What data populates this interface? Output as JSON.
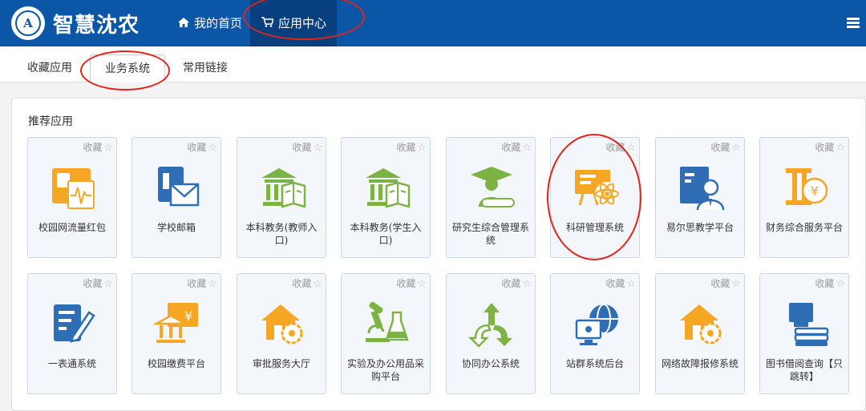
{
  "header": {
    "logo_text": "A",
    "brand": "智慧沈农",
    "nav": [
      {
        "label": "我的首页",
        "icon": "home-icon"
      },
      {
        "label": "应用中心",
        "icon": "cart-icon"
      }
    ]
  },
  "tabs": [
    {
      "label": "收藏应用"
    },
    {
      "label": "业务系统"
    },
    {
      "label": "常用链接"
    }
  ],
  "section": {
    "title": "推荐应用"
  },
  "favorite_label": "收藏",
  "apps": [
    {
      "name": "校园网流量红包",
      "icon": "network-traffic-icon"
    },
    {
      "name": "学校邮箱",
      "icon": "mail-icon"
    },
    {
      "name": "本科教务(教师入口)",
      "icon": "academic-building-icon"
    },
    {
      "name": "本科教务(学生入口)",
      "icon": "academic-building-icon"
    },
    {
      "name": "研究生综合管理系统",
      "icon": "graduate-icon"
    },
    {
      "name": "科研管理系统",
      "icon": "research-atom-icon"
    },
    {
      "name": "易尔思教学平台",
      "icon": "teacher-board-icon"
    },
    {
      "name": "财务综合服务平台",
      "icon": "finance-yuan-icon"
    },
    {
      "name": "一表通系统",
      "icon": "form-pen-icon"
    },
    {
      "name": "校园缴费平台",
      "icon": "payment-bank-icon"
    },
    {
      "name": "审批服务大厅",
      "icon": "approval-house-gear-icon"
    },
    {
      "name": "实验及办公用品采购平台",
      "icon": "lab-microscope-icon"
    },
    {
      "name": "协同办公系统",
      "icon": "collaboration-arrows-icon"
    },
    {
      "name": "站群系统后台",
      "icon": "site-globe-icon"
    },
    {
      "name": "网络故障报修系统",
      "icon": "repair-house-gear-icon"
    },
    {
      "name": "图书借阅查询【只跳转】",
      "icon": "library-books-icon"
    }
  ],
  "colors": {
    "header_bg": "#0c56a8",
    "active_nav_bg": "#083f7e",
    "accent_orange": "#f5a623",
    "icon_blue": "#2f6db5",
    "icon_green": "#7cb342",
    "annotation_red": "#e2231a"
  }
}
